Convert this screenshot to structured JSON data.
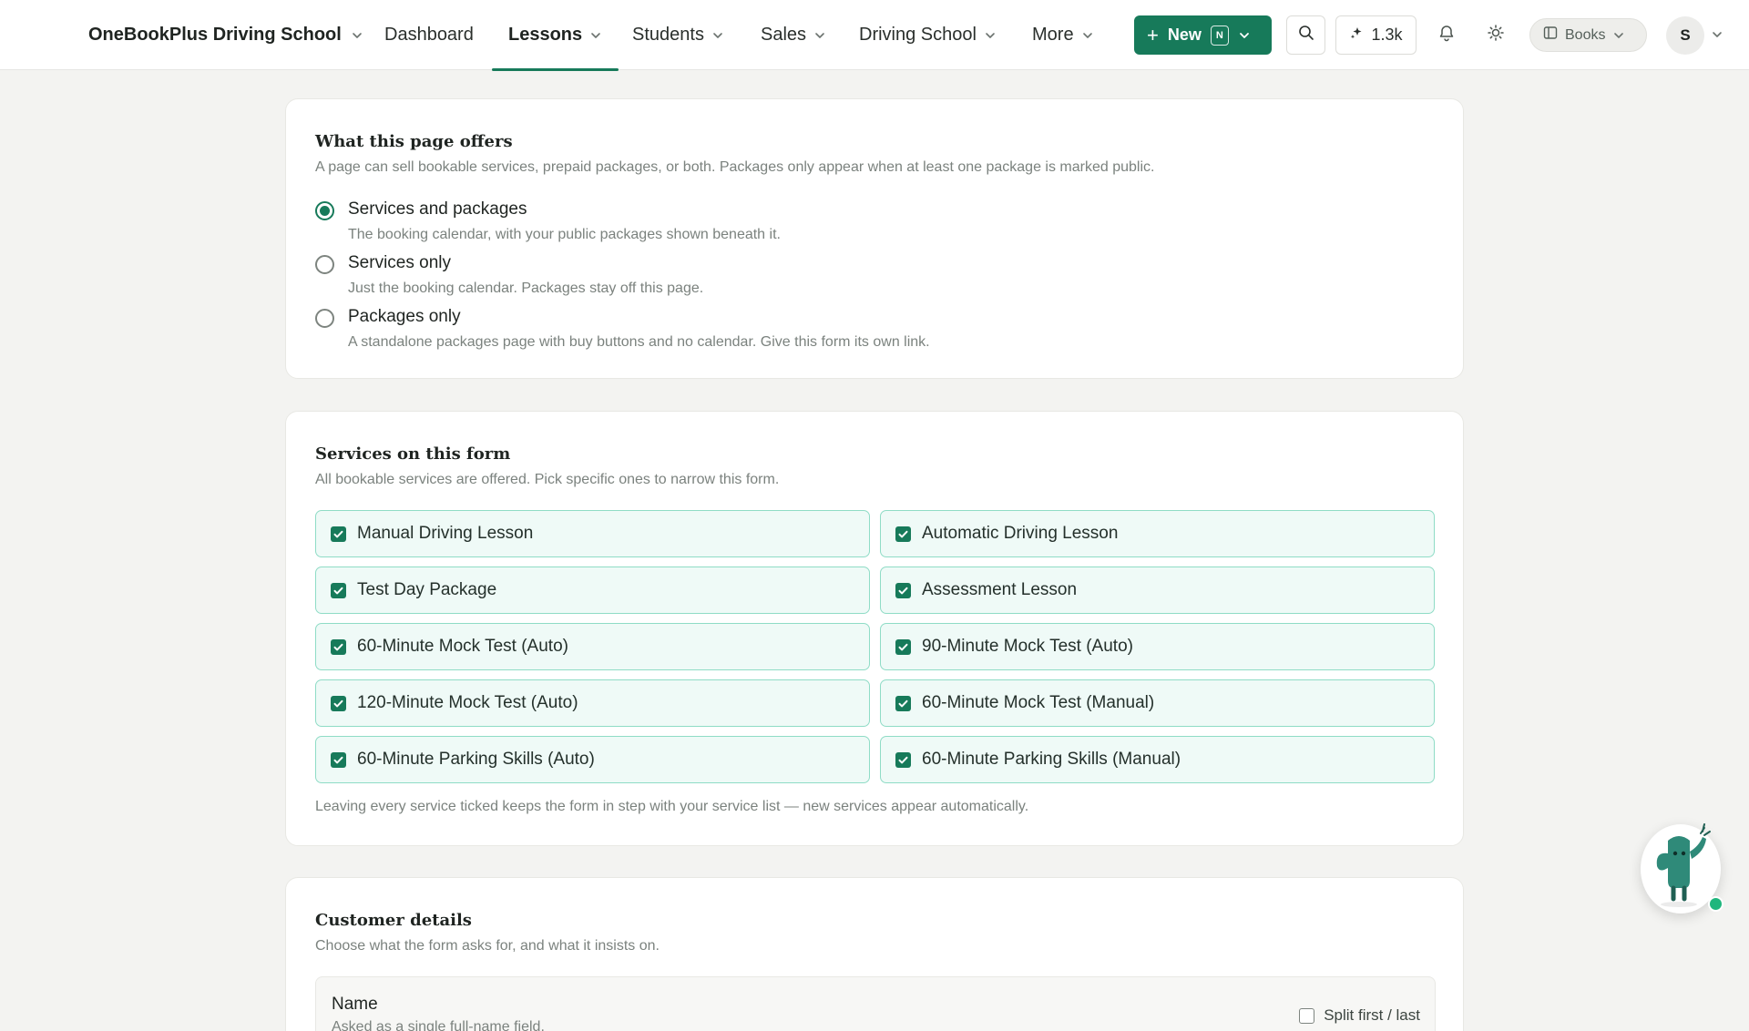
{
  "nav": {
    "brand": "OneBookPlus Driving School",
    "items": [
      {
        "label": "Dashboard",
        "has_menu": false
      },
      {
        "label": "Lessons",
        "has_menu": true,
        "active": true
      },
      {
        "label": "Students",
        "has_menu": true
      },
      {
        "label": "Sales",
        "has_menu": true
      },
      {
        "label": "Driving School",
        "has_menu": true
      },
      {
        "label": "More",
        "has_menu": true
      }
    ],
    "new_button": "New",
    "new_shortcut": "N",
    "credits": "1.3k",
    "workspace": "Books",
    "avatar_initial": "S",
    "accent": "#177a5a"
  },
  "offers": {
    "title": "What this page offers",
    "subtitle": "A page can sell bookable services, prepaid packages, or both. Packages only appear when at least one package is marked public.",
    "options": [
      {
        "label": "Services and packages",
        "desc": "The booking calendar, with your public packages shown beneath it.",
        "checked": true
      },
      {
        "label": "Services only",
        "desc": "Just the booking calendar. Packages stay off this page.",
        "checked": false
      },
      {
        "label": "Packages only",
        "desc": "A standalone packages page with buy buttons and no calendar. Give this form its own link.",
        "checked": false
      }
    ]
  },
  "services": {
    "title": "Services on this form",
    "subtitle": "All bookable services are offered. Pick specific ones to narrow this form.",
    "items": [
      {
        "label": "Manual Driving Lesson",
        "checked": true
      },
      {
        "label": "Automatic Driving Lesson",
        "checked": true
      },
      {
        "label": "Test Day Package",
        "checked": true
      },
      {
        "label": "Assessment Lesson",
        "checked": true
      },
      {
        "label": "60-Minute Mock Test (Auto)",
        "checked": true
      },
      {
        "label": "90-Minute Mock Test (Auto)",
        "checked": true
      },
      {
        "label": "120-Minute Mock Test (Auto)",
        "checked": true
      },
      {
        "label": "60-Minute Mock Test (Manual)",
        "checked": true
      },
      {
        "label": "60-Minute Parking Skills (Auto)",
        "checked": true
      },
      {
        "label": "60-Minute Parking Skills (Manual)",
        "checked": true
      }
    ],
    "footnote": "Leaving every service ticked keeps the form in step with your service list — new services appear automatically."
  },
  "customer": {
    "title": "Customer details",
    "subtitle": "Choose what the form asks for, and what it insists on.",
    "name_field": {
      "label": "Name",
      "desc": "Asked as a single full-name field.",
      "split_label": "Split first / last",
      "split_checked": false
    }
  }
}
